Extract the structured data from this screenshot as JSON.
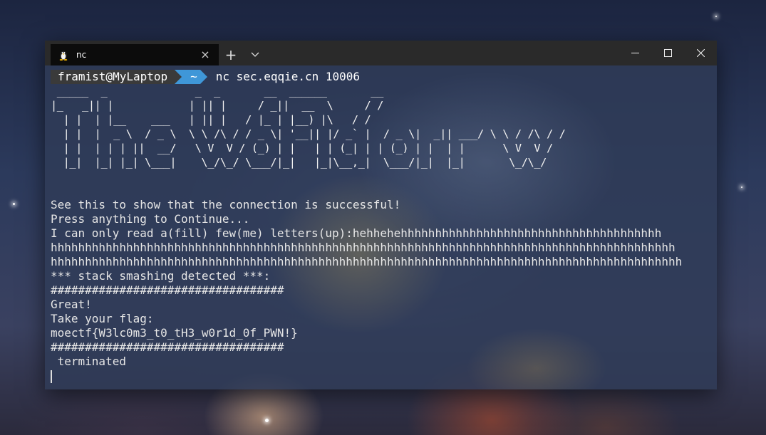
{
  "window": {
    "tab_title": "nc",
    "tab_icon": "linux-penguin-icon",
    "new_tab_label": "+",
    "dropdown_label": "⌵",
    "controls": {
      "minimize": "—",
      "maximize": "☐",
      "close": "✕"
    }
  },
  "prompt": {
    "user_host": "framist@MyLaptop",
    "directory": "~",
    "command": "nc sec.eqqie.cn 10006"
  },
  "ascii_art": " _____  _              _  _       __  ______       __\n|_   _|| |            | || |     / _||  __  \\     / /\n  | |  | |__    ___   | || |   / |_ | |__) |\\   / /\n  | |  |  _ \\  / _ \\  \\ \\ /\\ / / _ \\| '__|| |/ _` |  / _ \\|  _|| ___/ \\ \\ / /\\ / /\n  | |  | | | ||  __/   \\ V  V / (_) | |   | | (_| | | (_) | |  | |      \\ V  V /\n  |_|  |_| |_| \\___|    \\_/\\_/ \\___/|_|   |_|\\__,_|  \\___/|_|  |_|       \\_/\\_/",
  "output_lines": [
    "See this to show that the connection is successful!",
    "Press anything to Continue...",
    "I can only read a(fill) few(me) letters(up):hehhehehhhhhhhhhhhhhhhhhhhhhhhhhhhhhhhhhhhhhh",
    "hhhhhhhhhhhhhhhhhhhhhhhhhhhhhhhhhhhhhhhhhhhhhhhhhhhhhhhhhhhhhhhhhhhhhhhhhhhhhhhhhhhhhhhhhhh",
    "hhhhhhhhhhhhhhhhhhhhhhhhhhhhhhhhhhhhhhhhhhhhhhhhhhhhhhhhhhhhhhhhhhhhhhhhhhhhhhhhhhhhhhhhhhhh",
    "*** stack smashing detected ***:",
    "##################################",
    "Great!",
    "Take your flag:",
    "moectf{W3lc0m3_t0_tH3_w0r1d_0f_PWN!}",
    "##################################",
    " terminated"
  ]
}
